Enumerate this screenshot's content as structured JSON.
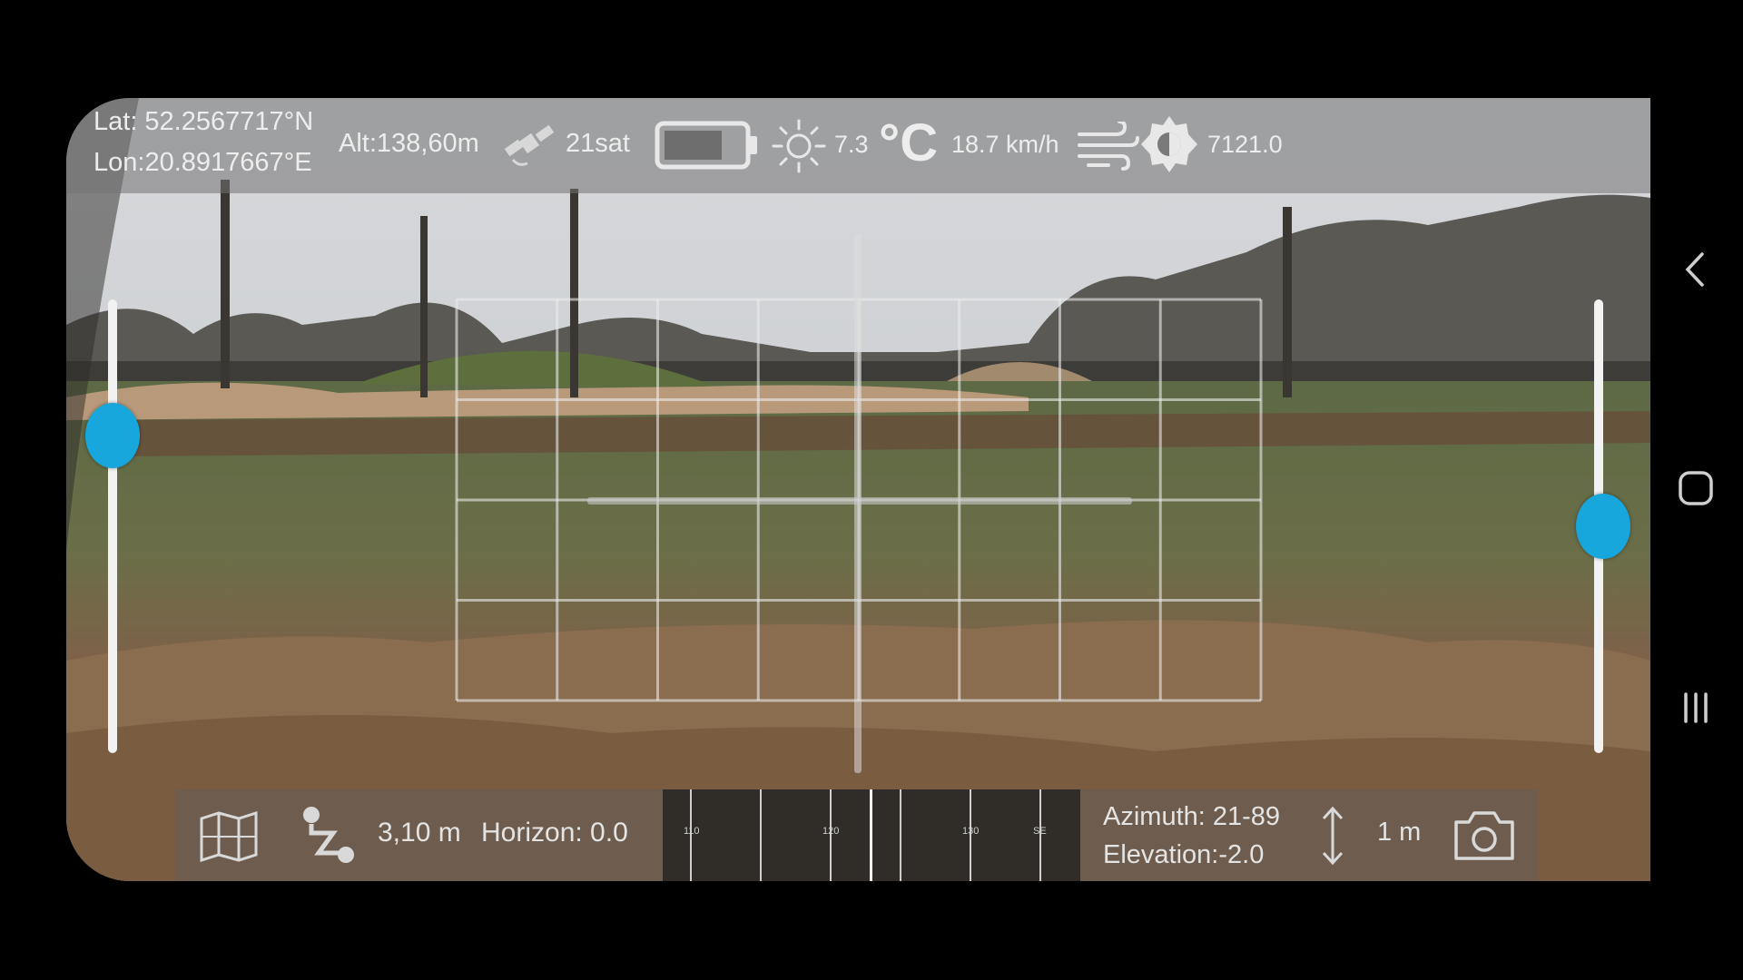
{
  "status_bar": {
    "latitude": "Lat: 52.2567717°N",
    "longitude": "Lon:20.8917667°E",
    "altitude": "Alt:138,60m",
    "satellites": "21sat",
    "battery_level": 0.75,
    "brightness": "7.3",
    "temperature_unit": "°C",
    "wind_speed": "18.7 km/h",
    "light_value": "7121.0"
  },
  "grid": {
    "columns": 8,
    "rows": 4
  },
  "left_slider": {
    "value": 0.7
  },
  "right_slider": {
    "value": 0.5
  },
  "bottom_bar": {
    "distance": "3,10 m",
    "horizon": "Horizon: 0.0",
    "compass_labels": [
      "110",
      "120",
      "130",
      "SE"
    ],
    "azimuth": "Azimuth: 21-89",
    "elevation": "Elevation:-2.0",
    "height_value": "1 m"
  },
  "icons": {
    "gps": "satellite-icon",
    "battery": "battery-icon",
    "sun": "sun-icon",
    "wind": "wind-icon",
    "light": "light-meter-icon",
    "map": "map-icon",
    "route": "route-icon",
    "height": "vertical-arrow-icon",
    "camera": "camera-icon"
  },
  "colors": {
    "accent": "#17a7dc",
    "overlay": "#ededed"
  }
}
